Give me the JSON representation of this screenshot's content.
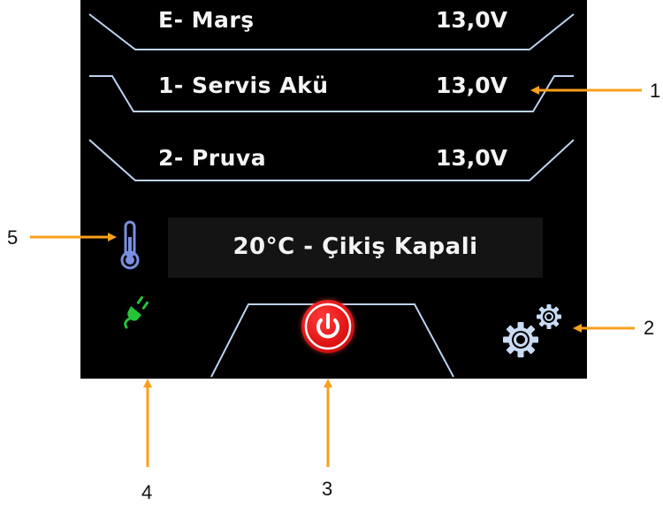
{
  "batteries": [
    {
      "name": "E- Marş",
      "voltage": "13,0V"
    },
    {
      "name": "1- Servis Akü",
      "voltage": "13,0V"
    },
    {
      "name": "2- Pruva",
      "voltage": "13,0V"
    }
  ],
  "status": {
    "text": "20°C - Çikiş Kapali"
  },
  "icons": {
    "thermometer": "thermometer-icon",
    "plug": "plug-icon",
    "power": "power-icon",
    "settings": "gear-icon"
  },
  "colors": {
    "screen_bg": "#000000",
    "frame_line": "#bcd2ee",
    "power_red": "#e01414",
    "plug_green": "#27c43a",
    "callout_orange": "#f7a01d"
  },
  "callouts": {
    "c1": "1",
    "c2": "2",
    "c3": "3",
    "c4": "4",
    "c5": "5"
  }
}
